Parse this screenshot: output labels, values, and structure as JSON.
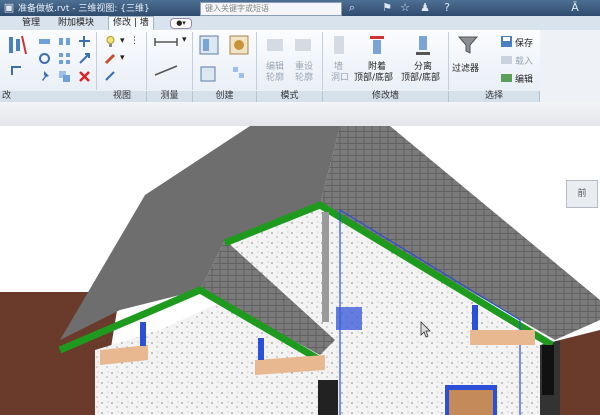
{
  "titlebar": {
    "title": "准备做板.rvt - 三维视图: {三维}",
    "search_placeholder": "键入关键字或短语"
  },
  "tabs": [
    {
      "label": "管理"
    },
    {
      "label": "附加模块"
    },
    {
      "label": "修改 | 墙"
    }
  ],
  "ribbon": {
    "panels": {
      "modify_partial": "改",
      "view": "视图",
      "measure": "测量",
      "create": "创建",
      "mode": "模式",
      "modify_wall": "修改墙",
      "select": "选择"
    },
    "buttons": {
      "edit_profile": [
        "编辑",
        "轮廓"
      ],
      "reset_profile": [
        "重设",
        "轮廓"
      ],
      "wall_opening": [
        "墙",
        "洞口"
      ],
      "attach": [
        "附着",
        "顶部/底部"
      ],
      "detach": [
        "分离",
        "顶部/底部"
      ],
      "filter": "过滤器",
      "save": "保存",
      "load": "载入",
      "edit": "编辑"
    }
  },
  "viewcube": {
    "label": "前"
  },
  "colors": {
    "roof": "#707070",
    "fascia": "#1e9b1e",
    "wall": "#f2f2f2",
    "ground": "#6a3b2a",
    "selection": "#2b4fd6"
  }
}
